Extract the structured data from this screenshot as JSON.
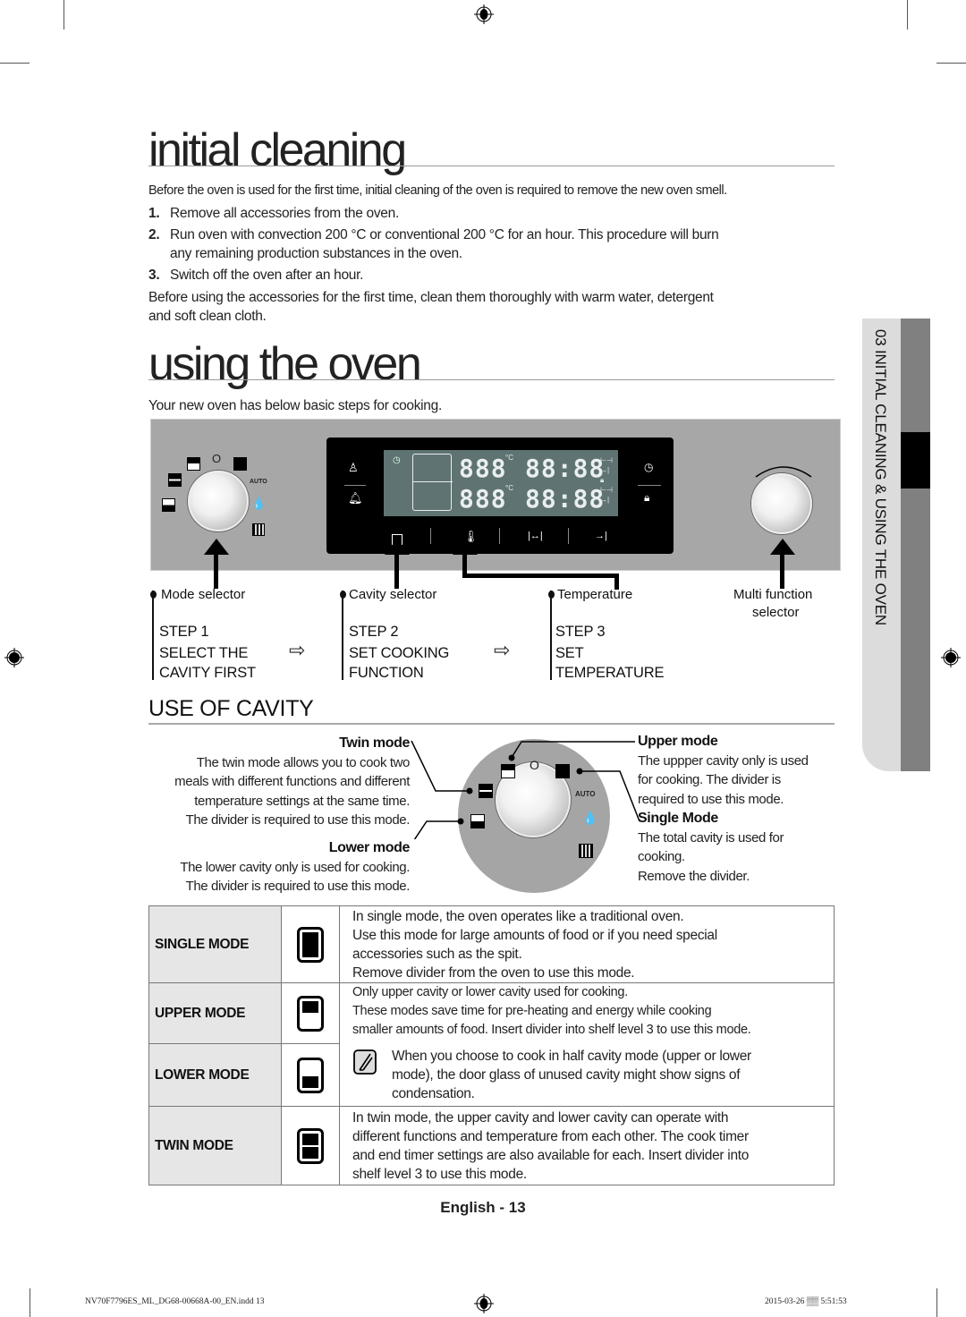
{
  "sections": {
    "initial_cleaning": {
      "title": "initial cleaning",
      "intro": "Before the oven is used for the first time, initial cleaning of the oven is required to remove the new oven smell.",
      "steps": [
        {
          "num": "1.",
          "text": "Remove all accessories from the oven."
        },
        {
          "num": "2.",
          "text": "Run oven with convection 200 °C or conventional 200 °C for an hour. This procedure will burn",
          "text2": "any remaining production substances in the oven."
        },
        {
          "num": "3.",
          "text": "Switch off the oven after an hour."
        }
      ],
      "outro_line1": "Before using the accessories for the first time, clean them thoroughly with warm water, detergent",
      "outro_line2": "and soft clean cloth."
    },
    "using_the_oven": {
      "title": "using the oven",
      "intro": "Your new oven has below basic steps for cooking."
    }
  },
  "control_panel": {
    "knob_mode_labels": {
      "off": "O",
      "auto": "AUTO"
    },
    "display": {
      "temp_upper": "888",
      "temp_lower": "888",
      "time_upper": "88:88",
      "time_lower": "88:88",
      "unit": "°C"
    },
    "icons": [
      "light-icon",
      "bell-icon",
      "clock-icon",
      "lock-icon",
      "cavity-icon",
      "thermometer-icon",
      "cook-time-icon",
      "end-time-icon"
    ]
  },
  "callouts": {
    "mode_selector": "Mode selector",
    "cavity_selector": "Cavity selector",
    "temperature": "Temperature",
    "multi_function_line1": "Multi function",
    "multi_function_line2": "selector"
  },
  "steps": [
    {
      "label": "STEP 1",
      "line1": "SELECT THE",
      "line2": "CAVITY FIRST"
    },
    {
      "label": "STEP 2",
      "line1": "SET COOKING",
      "line2": "FUNCTION"
    },
    {
      "label": "STEP 3",
      "line1": "SET",
      "line2": "TEMPERATURE"
    }
  ],
  "use_of_cavity": {
    "heading": "USE OF CAVITY",
    "twin": {
      "title": "Twin mode",
      "lines": [
        "The twin mode allows you to cook two",
        "meals with different functions and different",
        "temperature settings at the same time.",
        "The divider is required to use this mode."
      ]
    },
    "lower": {
      "title": "Lower mode",
      "lines": [
        "The lower cavity only is used for cooking.",
        "The divider is required to use this mode."
      ]
    },
    "upper": {
      "title": "Upper mode",
      "lines": [
        "The uppper cavity only is used",
        "for cooking. The divider is",
        "required to use this mode."
      ]
    },
    "single": {
      "title": "Single Mode",
      "lines": [
        "The total cavity is used for",
        "cooking.",
        "Remove the divider."
      ]
    },
    "dial_labels": {
      "off": "O",
      "auto": "AUTO"
    }
  },
  "modes_table": [
    {
      "name": "SINGLE MODE",
      "icon": "single-cavity-icon",
      "desc": [
        "In single mode, the oven operates like a traditional oven.",
        "Use this mode for large amounts of food or if you need special",
        "accessories such as the spit.",
        "Remove divider from the oven to use this mode."
      ]
    },
    {
      "name": "UPPER MODE",
      "icon": "upper-cavity-icon",
      "desc": [
        "Only upper cavity or lower cavity used for cooking.",
        "These modes save time for pre-heating and energy while cooking",
        "smaller amounts of food. Insert divider into shelf level 3 to use this mode."
      ]
    },
    {
      "name": "LOWER MODE",
      "icon": "lower-cavity-icon",
      "note": [
        "When you choose to cook in half cavity mode (upper or lower",
        "mode), the door glass of unused cavity might show signs of",
        "condensation."
      ]
    },
    {
      "name": "TWIN MODE",
      "icon": "twin-cavity-icon",
      "desc": [
        "In twin mode, the upper cavity and lower cavity can operate with",
        "different functions and temperature from each other. The cook timer",
        "and end timer settings are also available for each. Insert divider into",
        "shelf level 3 to use this mode."
      ]
    }
  ],
  "side_tab": {
    "label": "03  INITIAL CLEANING & USING THE OVEN"
  },
  "footer": {
    "page": "English - 13",
    "file": "NV70F7796ES_ML_DG68-00668A-00_EN.indd   13",
    "timestamp": "2015-03-26   ▒▒ 5:51:53"
  }
}
